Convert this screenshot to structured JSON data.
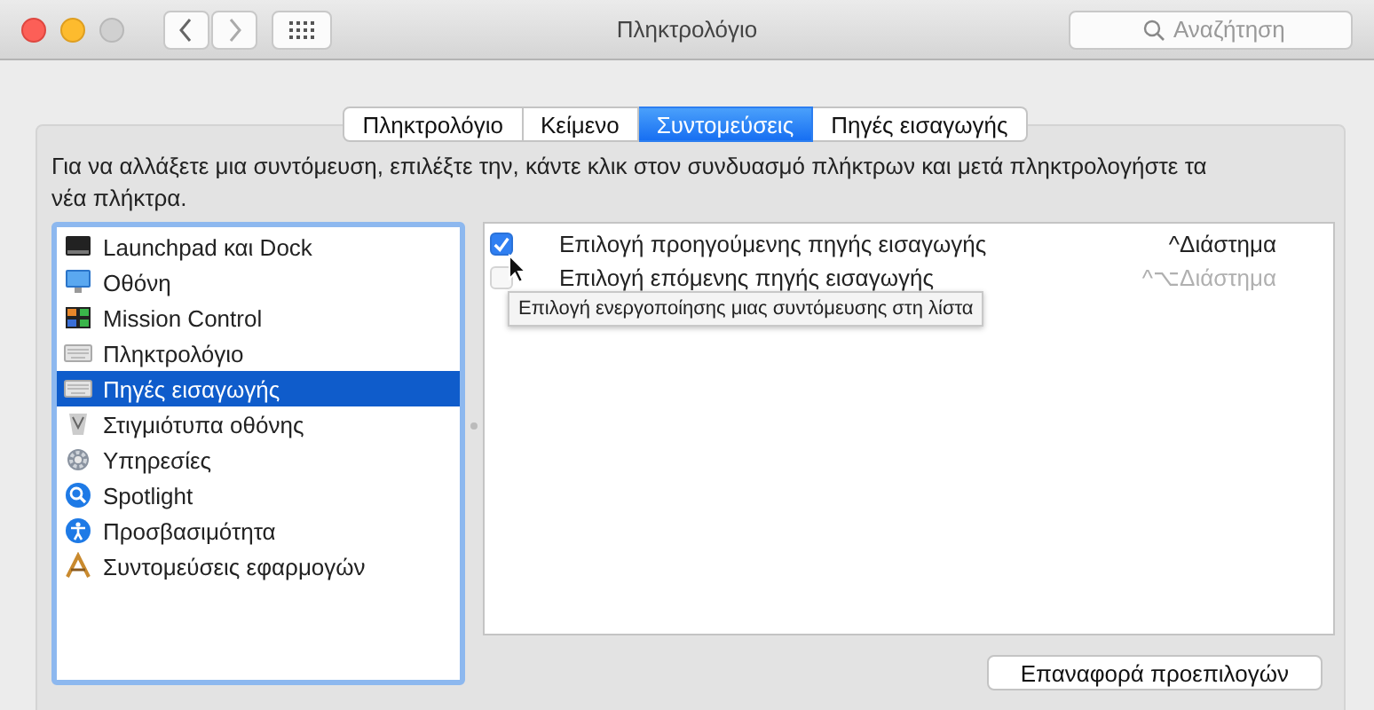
{
  "window": {
    "title": "Πληκτρολόγιο",
    "search": {
      "placeholder": "Αναζήτηση"
    }
  },
  "tabs": [
    {
      "label": "Πληκτρολόγιο",
      "selected": false
    },
    {
      "label": "Κείμενο",
      "selected": false
    },
    {
      "label": "Συντομεύσεις",
      "selected": true
    },
    {
      "label": "Πηγές εισαγωγής",
      "selected": false
    }
  ],
  "description": "Για να αλλάξετε μια συντόμευση, επιλέξτε την, κάντε κλικ στον συνδυασμό πλήκτρων και μετά πληκτρολογήστε τα νέα πλήκτρα.",
  "categories": [
    {
      "label": "Launchpad και Dock",
      "kind": "launchpad",
      "selected": false
    },
    {
      "label": "Οθόνη",
      "kind": "display",
      "selected": false
    },
    {
      "label": "Mission Control",
      "kind": "mission",
      "selected": false
    },
    {
      "label": "Πληκτρολόγιο",
      "kind": "keyboard",
      "selected": false
    },
    {
      "label": "Πηγές εισαγωγής",
      "kind": "keyboard",
      "selected": true
    },
    {
      "label": "Στιγμιότυπα οθόνης",
      "kind": "screenshot",
      "selected": false
    },
    {
      "label": "Υπηρεσίες",
      "kind": "services",
      "selected": false
    },
    {
      "label": "Spotlight",
      "kind": "spotlight",
      "selected": false
    },
    {
      "label": "Προσβασιμότητα",
      "kind": "accessibility",
      "selected": false
    },
    {
      "label": "Συντομεύσεις εφαρμογών",
      "kind": "apps",
      "selected": false
    }
  ],
  "shortcuts": [
    {
      "label": "Επιλογή προηγούμενης πηγής εισαγωγής",
      "keys": "^Διάστημα",
      "checked": true,
      "disabled": false
    },
    {
      "label": "Επιλογή επόμενης πηγής εισαγωγής",
      "keys": "^⌥Διάστημα",
      "checked": false,
      "disabled": true
    }
  ],
  "tooltip": "Επιλογή ενεργοποίησης μιας συντόμευσης στη λίστα",
  "reset_button": "Επαναφορά προεπιλογών"
}
